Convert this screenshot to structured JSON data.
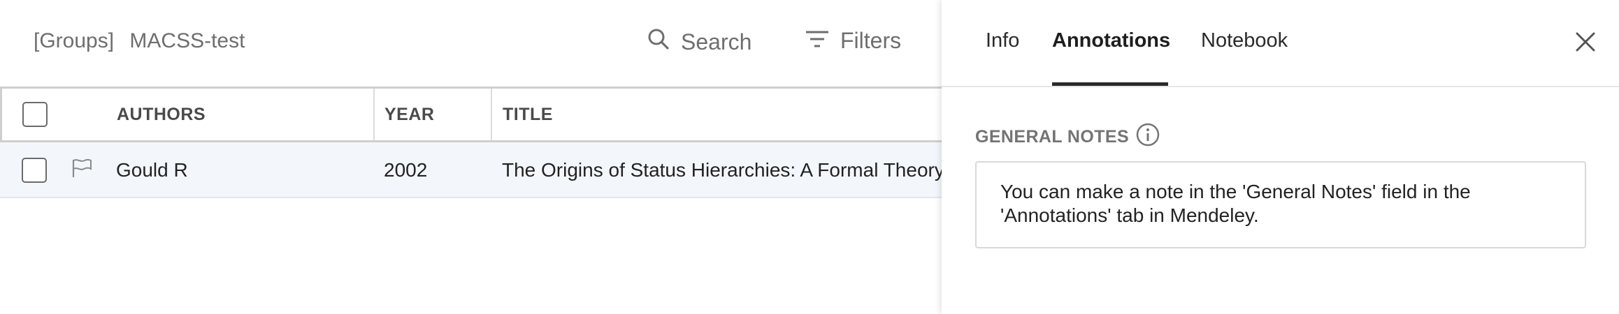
{
  "header": {
    "group_prefix": "[Groups]",
    "group_name": "MACSS-test",
    "search_label": "Search",
    "filters_label": "Filters"
  },
  "table": {
    "columns": [
      "AUTHORS",
      "YEAR",
      "TITLE"
    ],
    "rows": [
      {
        "authors": "Gould R",
        "year": "2002",
        "title": "The Origins of Status Hierarchies: A Formal Theory"
      }
    ]
  },
  "panel": {
    "tabs": [
      {
        "label": "Info",
        "active": false
      },
      {
        "label": "Annotations",
        "active": true
      },
      {
        "label": "Notebook",
        "active": false
      }
    ],
    "general_notes_label": "GENERAL NOTES",
    "general_notes_text": "You can make a note in the 'General Notes' field in the 'Annotations' tab in Mendeley."
  },
  "icons": {
    "search": "search-icon",
    "filters": "filter-icon",
    "flag": "flag-icon",
    "close": "close-icon",
    "info": "info-icon"
  },
  "colors": {
    "row_selected_bg": "#f3f7fc",
    "active_tab_underline": "#2a2a2a",
    "muted_text": "#6e6e6e"
  }
}
